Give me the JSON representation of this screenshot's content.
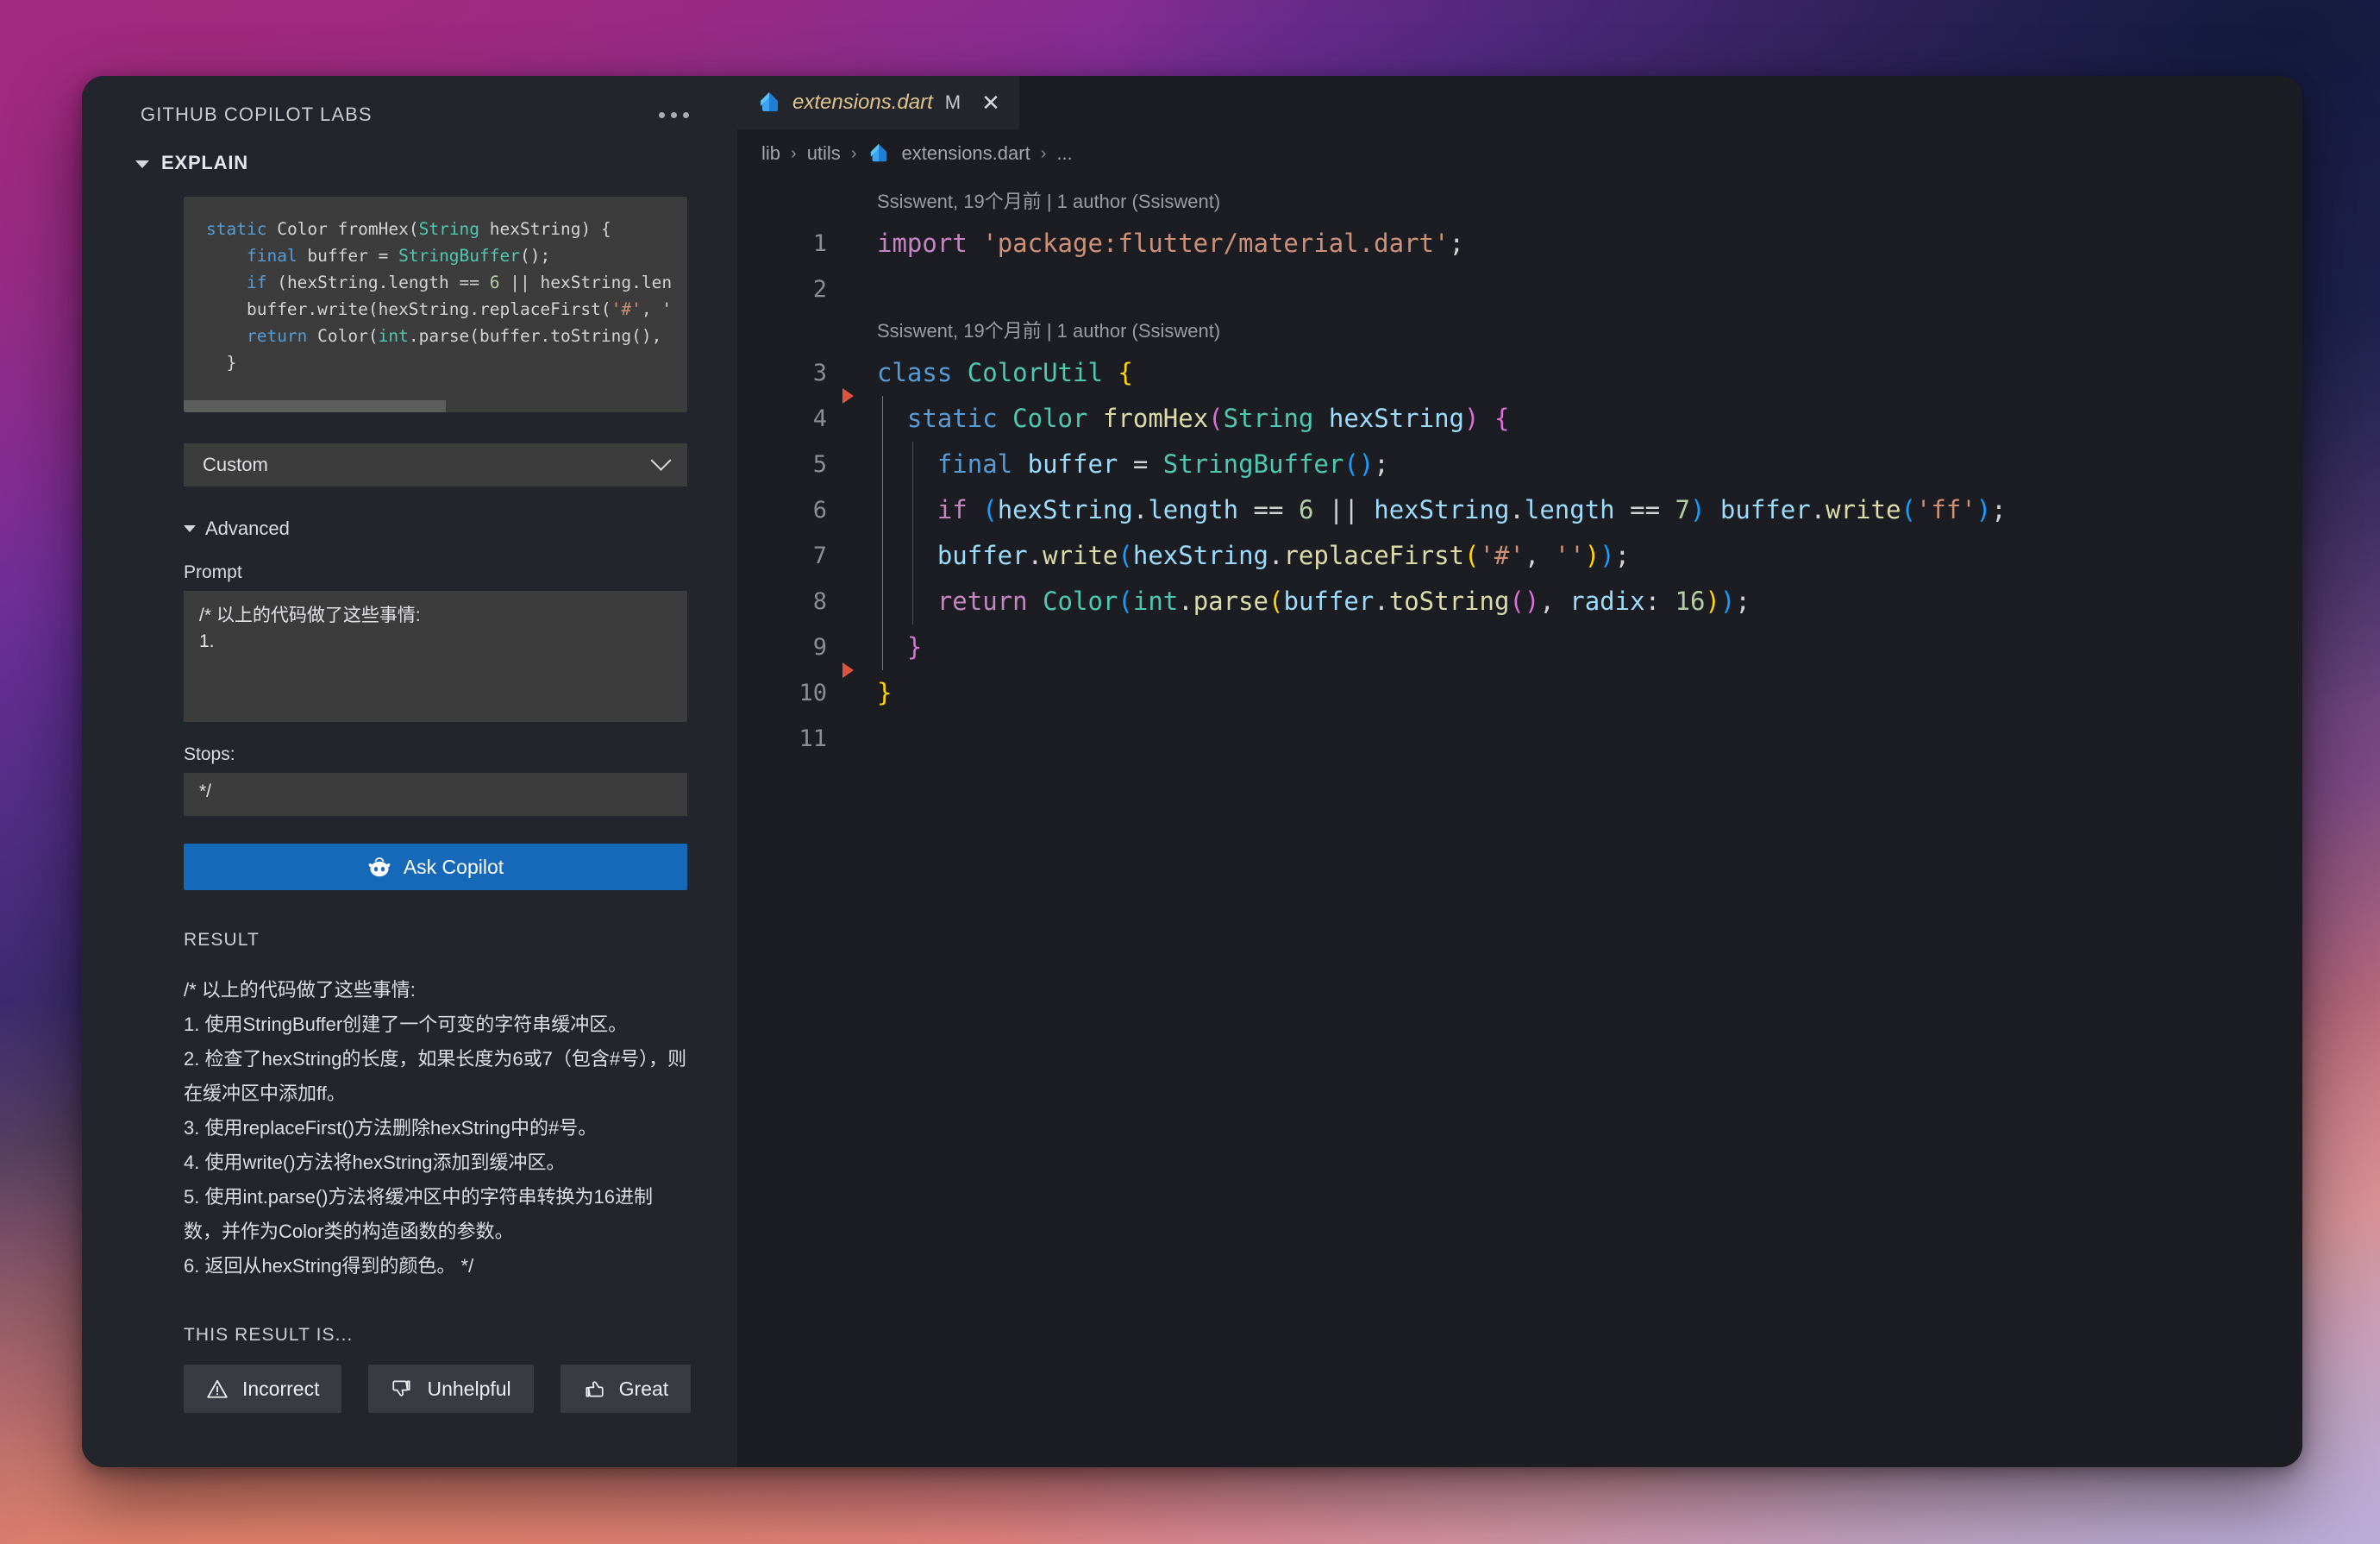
{
  "sidebar": {
    "panel_title": "GitHub Copilot Labs",
    "more_icon": "ellipsis-icon",
    "section_title": "Explain",
    "code_preview_lines": [
      "static Color fromHex(String hexString) {",
      "    final buffer = StringBuffer();",
      "    if (hexString.length == 6 || hexString.len",
      "    buffer.write(hexString.replaceFirst('#', '",
      "    return Color(int.parse(buffer.toString(),",
      "  }"
    ],
    "select": {
      "value": "Custom",
      "chevron_icon": "chevron-down-icon"
    },
    "advanced": {
      "label": "Advanced",
      "caret_icon": "caret-down-icon"
    },
    "prompt": {
      "label": "Prompt",
      "value": "/* 以上的代码做了这些事情:\n1."
    },
    "stops": {
      "label": "Stops:",
      "value": "*/"
    },
    "ask_button": {
      "label": "Ask Copilot",
      "icon": "copilot-icon"
    },
    "result": {
      "heading": "RESULT",
      "text": "/* 以上的代码做了这些事情:\n1. 使用StringBuffer创建了一个可变的字符串缓冲区。\n2. 检查了hexString的长度，如果长度为6或7（包含#号），则在缓冲区中添加ff。\n3. 使用replaceFirst()方法删除hexString中的#号。\n4. 使用write()方法将hexString添加到缓冲区。\n5. 使用int.parse()方法将缓冲区中的字符串转换为16进制数，并作为Color类的构造函数的参数。\n6. 返回从hexString得到的颜色。 */"
    },
    "feedback": {
      "heading": "THIS RESULT IS...",
      "buttons": [
        {
          "label": "Incorrect",
          "icon": "warning-triangle-icon"
        },
        {
          "label": "Unhelpful",
          "icon": "thumbs-down-icon"
        },
        {
          "label": "Great",
          "icon": "thumbs-up-icon"
        }
      ]
    }
  },
  "editor": {
    "tab": {
      "filename": "extensions.dart",
      "modified_badge": "M",
      "close_icon": "close-icon",
      "file_icon": "dart-file-icon"
    },
    "breadcrumb": {
      "items": [
        "lib",
        "utils",
        "extensions.dart",
        "..."
      ],
      "separator": "›",
      "file_icon": "dart-file-icon"
    },
    "blame_annotations": [
      "Ssiswent, 19个月前 | 1 author (Ssiswent)",
      "Ssiswent, 19个月前 | 1 author (Ssiswent)"
    ],
    "line_numbers": [
      "1",
      "2",
      "3",
      "4",
      "5",
      "6",
      "7",
      "8",
      "9",
      "10",
      "11"
    ],
    "code_lines": [
      "import 'package:flutter/material.dart';",
      "",
      "class ColorUtil {",
      "  static Color fromHex(String hexString) {",
      "    final buffer = StringBuffer();",
      "    if (hexString.length == 6 || hexString.length == 7) buffer.write('ff');",
      "    buffer.write(hexString.replaceFirst('#', ''));",
      "    return Color(int.parse(buffer.toString(), radix: 16));",
      "  }",
      "}",
      ""
    ],
    "fold_marker_lines": [
      4,
      10
    ]
  },
  "colors": {
    "accent_button": "#1668b8",
    "panel_bg": "#22252c",
    "editor_bg": "#1b1d23",
    "tab_filename": "#e0c48c",
    "fold_marker": "#e0543e"
  }
}
